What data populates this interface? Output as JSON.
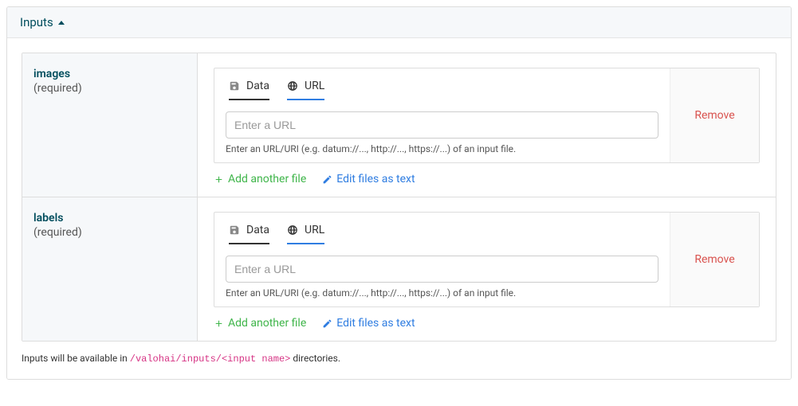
{
  "panel": {
    "title": "Inputs"
  },
  "inputs": [
    {
      "name": "images",
      "required_label": "(required)",
      "tabs": {
        "data": "Data",
        "url": "URL"
      },
      "url_placeholder": "Enter a URL",
      "help": "Enter an URL/URI (e.g. datum://..., http://..., https://...) of an input file.",
      "remove": "Remove",
      "add_label": "Add another file",
      "edit_label": "Edit files as text"
    },
    {
      "name": "labels",
      "required_label": "(required)",
      "tabs": {
        "data": "Data",
        "url": "URL"
      },
      "url_placeholder": "Enter a URL",
      "help": "Enter an URL/URI (e.g. datum://..., http://..., https://...) of an input file.",
      "remove": "Remove",
      "add_label": "Add another file",
      "edit_label": "Edit files as text"
    }
  ],
  "footer": {
    "prefix": "Inputs will be available in ",
    "code": "/valohai/inputs/<input name>",
    "suffix": " directories."
  }
}
